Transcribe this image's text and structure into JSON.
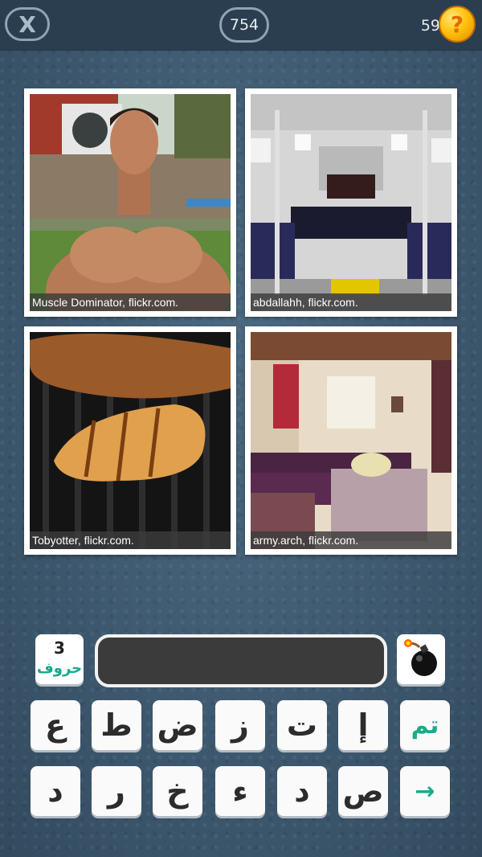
{
  "header": {
    "close_label": "X",
    "level": "754",
    "coins": "59",
    "coin_symbol": "?"
  },
  "photos": [
    {
      "credit": "Muscle Dominator, flickr.com."
    },
    {
      "credit": "abdallahh, flickr.com."
    },
    {
      "credit": "Tobyotter, flickr.com."
    },
    {
      "credit": "army.arch, flickr.com."
    }
  ],
  "answer": {
    "letters_count": "3",
    "letters_label": "حروف",
    "value": ""
  },
  "keyboard": {
    "row1": [
      "ع",
      "ط",
      "ض",
      "ز",
      "ت",
      "إ"
    ],
    "row1_action": "تم",
    "row2": [
      "د",
      "ر",
      "خ",
      "ء",
      "د",
      "ص"
    ],
    "row2_action": "→"
  },
  "colors": {
    "accent": "#1bab8a",
    "coin": "#ffc20e",
    "background": "#3f5a70"
  }
}
